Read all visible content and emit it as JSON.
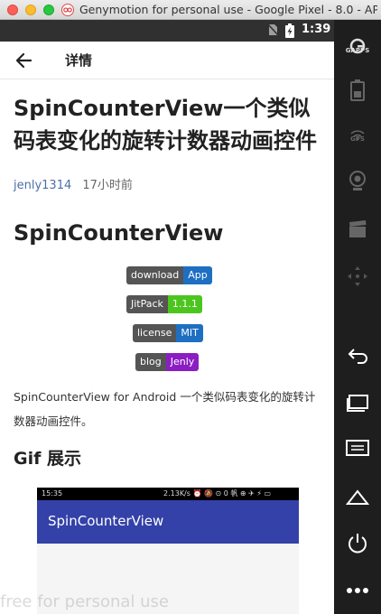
{
  "window": {
    "title": "Genymotion for personal use - Google Pixel - 8.0 - AP..."
  },
  "statusbar": {
    "time": "1:39"
  },
  "toolbar": {
    "title": "详情"
  },
  "article": {
    "title": "SpinCounterView一个类似码表变化的旋转计数器动画控件",
    "author": "jenly1314",
    "time": "17小时前",
    "heading1": "SpinCounterView",
    "badges": [
      {
        "label": "download",
        "value": "App",
        "color": "#1e6fc2"
      },
      {
        "label": "JitPack",
        "value": "1.1.1",
        "color": "#4cc61e"
      },
      {
        "label": "license",
        "value": "MIT",
        "color": "#1e6fc2"
      },
      {
        "label": "blog",
        "value": "Jenly",
        "color": "#8a1ec2"
      }
    ],
    "paragraph": "SpinCounterView for Android 一个类似码表变化的旋转计数器动画控件。",
    "heading2": "Gif 展示",
    "gif": {
      "time": "15:35",
      "status_right": "2.13K/s ⏰ 🔕 ⊙ 0 帆 ⊕ ✈ ⚡ ▭",
      "app_title": "SpinCounterView",
      "bar_color": "#3341a8"
    }
  },
  "watermark": "free for personal use",
  "side_toolbar": {
    "gapps_label": "GAPPS",
    "gps_label": "GPS"
  }
}
